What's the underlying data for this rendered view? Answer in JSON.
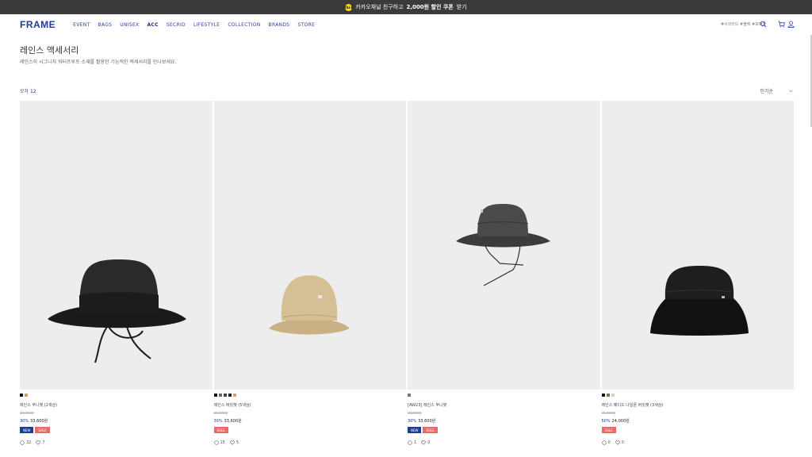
{
  "topbar": {
    "icon": "kakao-talk-icon",
    "pre": "카카오채널 친구하고",
    "bold": "2,000원 할인 쿠폰",
    "post": "받기"
  },
  "header": {
    "logo": "FRAME",
    "nav": [
      "EVENT",
      "BAGS",
      "UNISEX",
      "ACC",
      "SECRID",
      "LIFESTYLE",
      "COLLECTION",
      "BRANDS",
      "STORE"
    ],
    "active_nav": "ACC",
    "tags": "#시크리드 #블랙 #모바라",
    "icons": [
      "search-icon",
      "cart-icon",
      "user-icon"
    ]
  },
  "page": {
    "title": "레인스 액세서리",
    "description": "레인스의 시그니처 워터프루프 소재를 활용한 기능적인 액세서리를 만나보세요.",
    "count_label": "모자",
    "count": "12",
    "sort": "인기순"
  },
  "colors": {
    "brand": "#1e3a9a",
    "sale": "#e96a6a",
    "topbar": "#3a3a3a"
  },
  "products": [
    {
      "name": "레인스 부니햇 (2색상)",
      "original": "48,000원",
      "discount": "30%",
      "price": "33,600원",
      "badges": [
        "NEW",
        "SALE"
      ],
      "swatches": [
        "#111111",
        "#c8a878"
      ],
      "reviews": "32",
      "likes": "7"
    },
    {
      "name": "레인스 버킷햇 (5색상)",
      "original": "48,000원",
      "discount": "30%",
      "price": "33,600원",
      "badges": [
        "SALE"
      ],
      "swatches": [
        "#111111",
        "#666666",
        "#444444",
        "#222222",
        "#c8a878"
      ],
      "reviews": "15",
      "likes": "5"
    },
    {
      "name": "[AW23] 레인스 부니햇",
      "original": "48,000원",
      "discount": "30%",
      "price": "33,600원",
      "badges": [
        "NEW",
        "SALE"
      ],
      "swatches": [
        "#777777"
      ],
      "reviews": "1",
      "likes": "0"
    },
    {
      "name": "레인스 패디드 나일론 버킷햇 (3색상)",
      "original": "48,000원",
      "discount": "50%",
      "price": "24,000원",
      "badges": [
        "SALE"
      ],
      "swatches": [
        "#111111",
        "#8a6a4a",
        "#d8d0c8"
      ],
      "reviews": "0",
      "likes": "0"
    }
  ]
}
